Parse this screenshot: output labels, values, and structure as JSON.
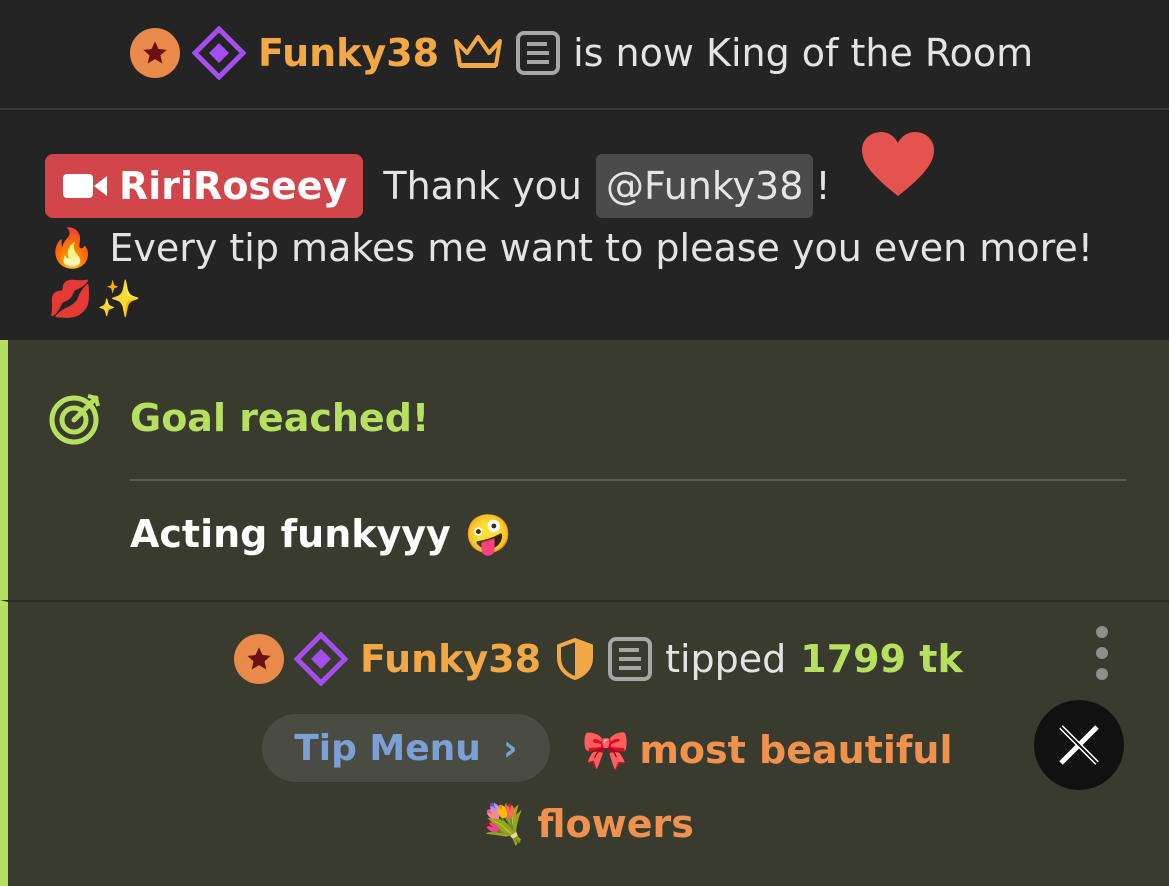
{
  "king_notice": {
    "username": "Funky38",
    "text": "is now King of the Room",
    "icons": [
      "star-badge-icon",
      "diamond-badge-icon",
      "crown-icon",
      "document-icon"
    ]
  },
  "broadcaster_message": {
    "broadcaster": "RiriRoseey",
    "text_before": "Thank you",
    "mention": "@Funky38",
    "text_after": "!",
    "line2": "Every tip makes me want to please you even more!",
    "emoji_heart": "❤️",
    "emoji_fire": "🔥",
    "emoji_kiss": "💋",
    "emoji_sparkles": "✨",
    "icons": [
      "video-camera-icon",
      "heart-icon"
    ]
  },
  "goal": {
    "title": "Goal reached!",
    "description": "Acting funkyyy",
    "emoji": "🤪",
    "icons": [
      "target-icon"
    ]
  },
  "tip": {
    "username": "Funky38",
    "tipped_label": "tipped",
    "amount": "1799 tk",
    "tip_menu_label": "Tip Menu",
    "tip_menu_chevron": "›",
    "item_emoji": "🎀",
    "item_line1": "most beautiful",
    "item_emoji2": "💐",
    "item_line2": "flowers",
    "icons": [
      "star-badge-icon",
      "diamond-badge-icon",
      "shield-icon",
      "document-icon",
      "more-icon",
      "x-close-icon"
    ]
  },
  "colors": {
    "username": "#f2a845",
    "goal_accent": "#b8e060",
    "broadcaster_bg": "#d2454a",
    "tip_menu_text": "#7aa0d6",
    "tip_item": "#f0924e"
  }
}
